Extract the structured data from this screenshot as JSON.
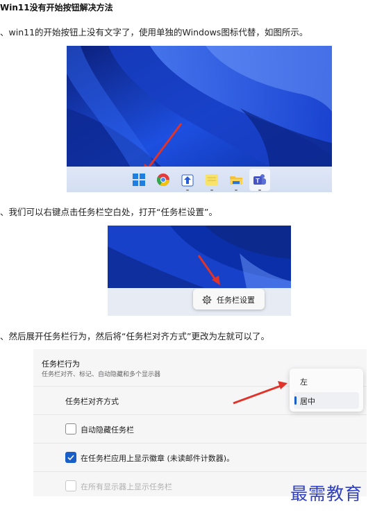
{
  "article": {
    "title": "Win11没有开始按钮解决方法",
    "step1": "、win11的开始按钮上没有文字了，使用单独的Windows图标代替，如图所示。",
    "step2": "、我们可以右键点击任务栏空白处，打开“任务栏设置”。",
    "step3": "、然后展开任务栏行为，然后将“任务栏对齐方式”更改为左就可以了。"
  },
  "figure1": {
    "taskbar_icons": [
      "windows-start-icon",
      "chrome-icon",
      "store-upload-icon",
      "notes-icon",
      "folder-icon",
      "teams-icon"
    ]
  },
  "figure2": {
    "context_menu_item": "任务栏设置",
    "context_menu_icon": "gear-icon"
  },
  "figure3": {
    "section_title": "任务栏行为",
    "section_subtitle": "任务栏对齐、标记、自动隐藏和多个显示器",
    "alignment_label": "任务栏对齐方式",
    "alignment_options": [
      "左",
      "居中"
    ],
    "alignment_selected": "居中",
    "checkboxes": [
      {
        "label": "自动隐藏任务栏",
        "checked": false,
        "enabled": true
      },
      {
        "label": "在任务栏应用上显示徽章 (未读邮件计数器)。",
        "checked": true,
        "enabled": true
      },
      {
        "label": "在所有显示器上显示任务栏",
        "checked": false,
        "enabled": false
      }
    ]
  },
  "watermark": "最需教育",
  "colors": {
    "wallpaper_blue": "#0a2fa8",
    "accent": "#1a5fc8",
    "arrow_red": "#e0332a",
    "watermark": "#2f3fbf"
  }
}
